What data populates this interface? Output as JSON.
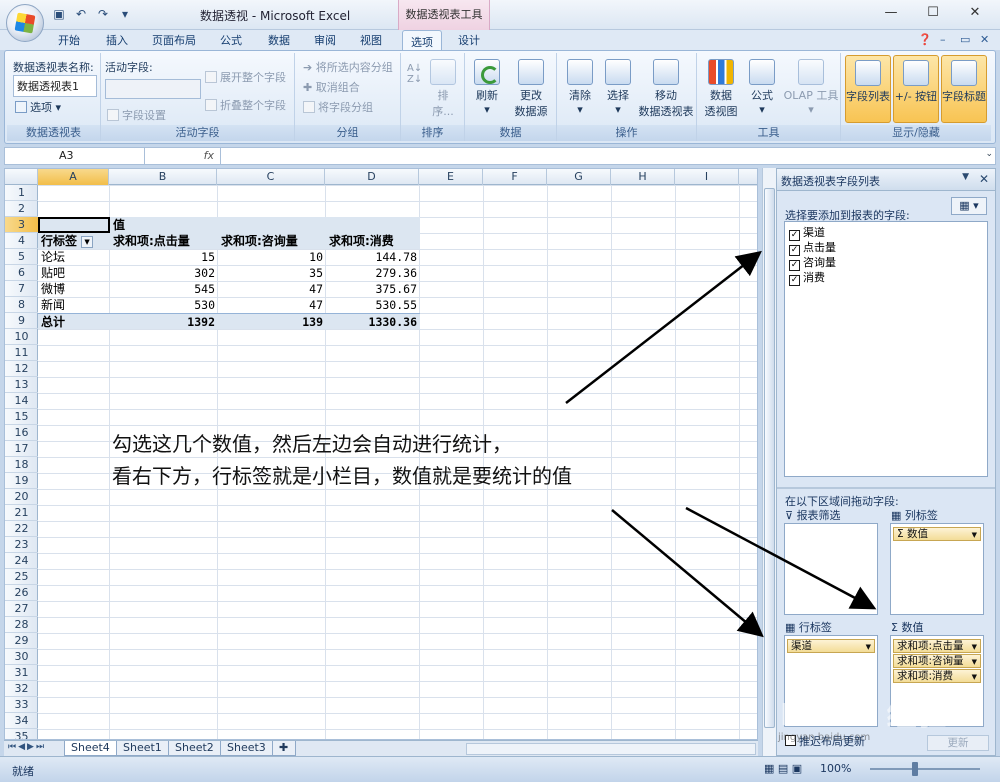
{
  "window": {
    "title": "数据透视 - Microsoft Excel",
    "context_tab": "数据透视表工具",
    "min": "—",
    "max": "☐",
    "close": "✕"
  },
  "tabs": [
    "开始",
    "插入",
    "页面布局",
    "公式",
    "数据",
    "审阅",
    "视图",
    "选项",
    "设计"
  ],
  "active_tab": "选项",
  "ribbon": {
    "pivot_name_label": "数据透视表名称:",
    "pivot_name_value": "数据透视表1",
    "options_btn": "选项 ▾",
    "group_pivot": "数据透视表",
    "active_field_label": "活动字段:",
    "field_settings": "字段设置",
    "expand_field": "展开整个字段",
    "collapse_field": "折叠整个字段",
    "group_active_field": "活动字段",
    "group_selection": "将所选内容分组",
    "ungroup": "取消组合",
    "group_field": "将字段分组",
    "group_group": "分组",
    "sort": "排序...",
    "group_sort": "排序",
    "refresh": "刷新",
    "change_source_1": "更改",
    "change_source_2": "数据源",
    "group_data": "数据",
    "clear": "清除",
    "select": "选择",
    "move_1": "移动",
    "move_2": "数据透视表",
    "group_actions": "操作",
    "pivot_chart_1": "数据",
    "pivot_chart_2": "透视图",
    "formulas": "公式",
    "olap": "OLAP 工具",
    "group_tools": "工具",
    "field_list": "字段列表",
    "plus_minus": "+/- 按钮",
    "field_headers": "字段标题",
    "group_show": "显示/隐藏"
  },
  "formula_bar": {
    "name_box": "A3",
    "fx": "fx"
  },
  "columns": [
    "A",
    "B",
    "C",
    "D",
    "E",
    "F",
    "G",
    "H",
    "I"
  ],
  "rows": [
    "1",
    "2",
    "3",
    "4",
    "5",
    "6",
    "7",
    "8",
    "9",
    "10",
    "11",
    "12",
    "13",
    "14",
    "15",
    "16",
    "17",
    "18",
    "19",
    "20",
    "21",
    "22",
    "23",
    "24",
    "25",
    "26",
    "27",
    "28",
    "29",
    "30",
    "31",
    "32",
    "33",
    "34",
    "35"
  ],
  "pivot": {
    "values_label": "值",
    "row_label": "行标签",
    "headers": [
      "求和项:点击量",
      "求和项:咨询量",
      "求和项:消费"
    ],
    "rows": [
      {
        "label": "论坛",
        "clicks": "15",
        "consults": "10",
        "spend": "144.78"
      },
      {
        "label": "贴吧",
        "clicks": "302",
        "consults": "35",
        "spend": "279.36"
      },
      {
        "label": "微博",
        "clicks": "545",
        "consults": "47",
        "spend": "375.67"
      },
      {
        "label": "新闻",
        "clicks": "530",
        "consults": "47",
        "spend": "530.55"
      }
    ],
    "total": {
      "label": "总计",
      "clicks": "1392",
      "consults": "139",
      "spend": "1330.36"
    }
  },
  "annotation": {
    "line1": "勾选这几个数值，然后左边会自动进行统计，",
    "line2": "看右下方，行标签就是小栏目，数值就是要统计的值"
  },
  "sheets": [
    "Sheet4",
    "Sheet1",
    "Sheet2",
    "Sheet3"
  ],
  "active_sheet": "Sheet4",
  "field_pane": {
    "title": "数据透视表字段列表",
    "choose_label": "选择要添加到报表的字段:",
    "fields": [
      {
        "name": "渠道",
        "checked": "✓"
      },
      {
        "name": "点击量",
        "checked": "✓"
      },
      {
        "name": "咨询量",
        "checked": "✓"
      },
      {
        "name": "消费",
        "checked": "✓"
      }
    ],
    "drag_label": "在以下区域间拖动字段:",
    "report_filter": "报表筛选",
    "column_labels": "列标签",
    "row_labels": "行标签",
    "values": "数值",
    "col_chip": "Σ 数值",
    "row_chip": "渠道",
    "value_chips": [
      "求和项:点击量",
      "求和项:咨询量",
      "求和项:消费"
    ],
    "defer": "推迟布局更新",
    "update": "更新"
  },
  "status": {
    "ready": "就绪",
    "zoom": "100%"
  },
  "watermark": {
    "brand": "Baidu 经验",
    "url": "jingyan.baidu.com"
  }
}
